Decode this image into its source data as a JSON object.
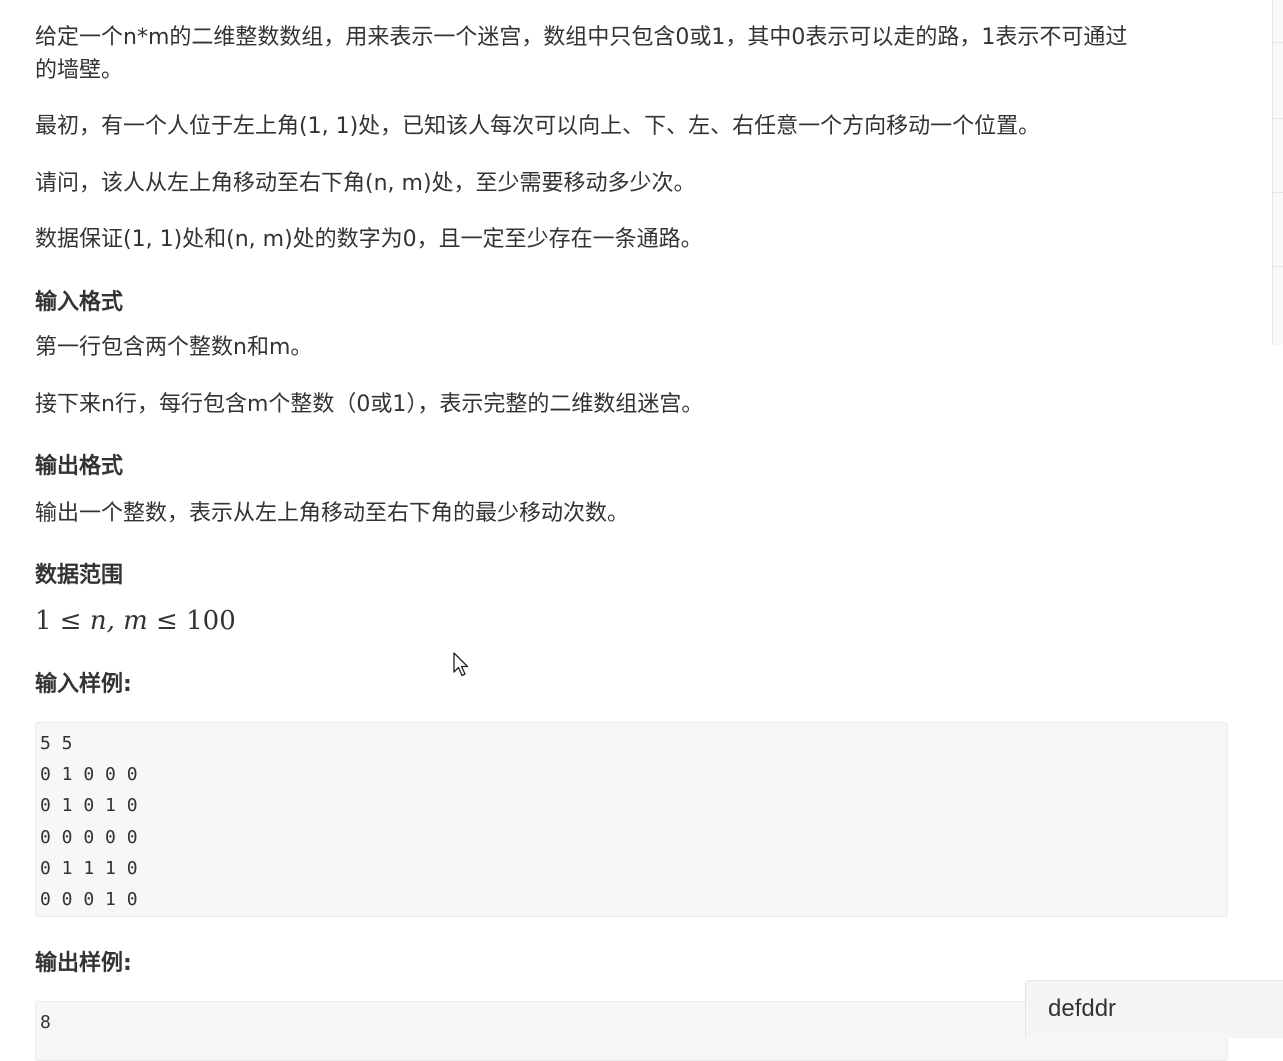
{
  "problem": {
    "desc_line1": "给定一个n*m的二维整数数组，用来表示一个迷宫，数组中只包含0或1，其中0表示可以走的路，1表示不可通过",
    "desc_line2": "的墙壁。",
    "desc2": "最初，有一个人位于左上角(1, 1)处，已知该人每次可以向上、下、左、右任意一个方向移动一个位置。",
    "desc3": "请问，该人从左上角移动至右下角(n, m)处，至少需要移动多少次。",
    "desc4": "数据保证(1, 1)处和(n, m)处的数字为0，且一定至少存在一条通路。"
  },
  "input_format": {
    "heading": "输入格式",
    "line1": "第一行包含两个整数n和m。",
    "line2": "接下来n行，每行包含m个整数（0或1），表示完整的二维数组迷宫。"
  },
  "output_format": {
    "heading": "输出格式",
    "line1": "输出一个整数，表示从左上角移动至右下角的最少移动次数。"
  },
  "data_range": {
    "heading": "数据范围",
    "formula_left": "1 ≤ ",
    "formula_vars": "n, m",
    "formula_right": " ≤ 100"
  },
  "sample_input": {
    "heading": "输入样例:",
    "lines": [
      "5 5",
      "0 1 0 0 0",
      "0 1 0 1 0",
      "0 0 0 0 0",
      "0 1 1 1 0",
      "0 0 0 1 0"
    ]
  },
  "sample_output": {
    "heading": "输出样例:",
    "lines": [
      "8"
    ]
  },
  "overlay": {
    "toast_text": "defddr",
    "cursor_icon": "mouse-pointer-icon"
  }
}
